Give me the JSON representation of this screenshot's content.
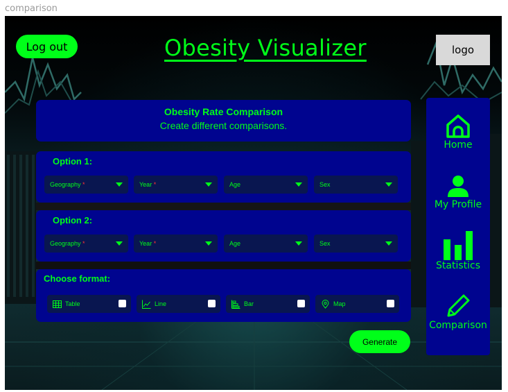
{
  "frame": {
    "label": "comparison"
  },
  "header": {
    "logout_label": "Log out",
    "title": "Obesity Visualizer",
    "logo_label": "logo"
  },
  "summary": {
    "title": "Obesity Rate Comparison",
    "subtitle": "Create different comparisons."
  },
  "option1": {
    "title": "Option 1:",
    "dropdowns": [
      {
        "label": "Geography",
        "required": "*"
      },
      {
        "label": "Year",
        "required": "*"
      },
      {
        "label": "Age",
        "required": ""
      },
      {
        "label": "Sex",
        "required": ""
      }
    ]
  },
  "option2": {
    "title": "Option 2:",
    "dropdowns": [
      {
        "label": "Geography",
        "required": "*"
      },
      {
        "label": "Year",
        "required": "*"
      },
      {
        "label": "Age",
        "required": ""
      },
      {
        "label": "Sex",
        "required": ""
      }
    ]
  },
  "format": {
    "title": "Choose format:",
    "options": [
      {
        "label": "Table",
        "icon": "table-icon",
        "checked": false
      },
      {
        "label": "Line",
        "icon": "line-chart-icon",
        "checked": false
      },
      {
        "label": "Bar",
        "icon": "bar-chart-icon",
        "checked": false
      },
      {
        "label": "Map",
        "icon": "map-pin-icon",
        "checked": false
      }
    ]
  },
  "generate_label": "Generate",
  "sidebar": {
    "items": [
      {
        "label": "Home",
        "icon": "home-icon"
      },
      {
        "label": "My Profile",
        "icon": "user-icon"
      },
      {
        "label": "Statistics",
        "icon": "statistics-icon"
      },
      {
        "label": "Comparison",
        "icon": "pencil-icon"
      }
    ]
  },
  "colors": {
    "accent": "#00ff19",
    "panel": "#00048f",
    "field": "#091650",
    "required": "#ff3333",
    "logo_bg": "#d9d9d9"
  }
}
